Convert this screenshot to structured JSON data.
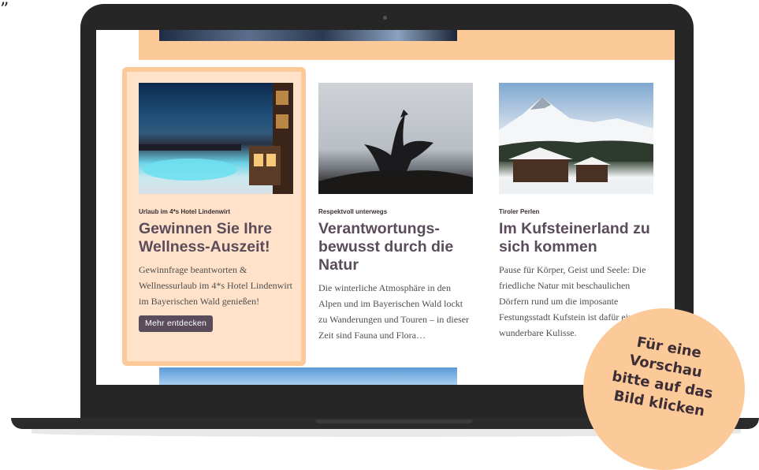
{
  "quote_mark": "”",
  "colors": {
    "accent": "#fcc998",
    "title": "#5a4c5b",
    "button": "#5a4c5b",
    "lid": "#262626"
  },
  "cards": [
    {
      "tag": "Urlaub im 4*s Hotel Lindenwirt",
      "title": "Gewinnen Sie Ihre Wellness-Auszeit!",
      "text": "Gewinnfrage beantworten & Wellnessurlaub im 4*s Hotel Lindenwirt im Bayerischen Wald genießen!",
      "button": "Mehr entdecken"
    },
    {
      "tag": "Respektvoll unterwegs",
      "title": "Verantwortungs-bewusst durch die Natur",
      "text": "Die winterliche Atmosphäre in den Alpen und im Bayerischen Wald lockt zu Wanderungen und Touren – in dieser Zeit sind Fauna und Flora…"
    },
    {
      "tag": "Tiroler Perlen",
      "title": "Im Kufsteinerland zu sich kommen",
      "text": "Pause für Körper, Geist und Seele: Die friedliche Natur mit beschaulichen Dörfern rund um die imposante Festungsstadt Kufstein ist dafür eine wunderbare Kulisse."
    }
  ],
  "badge": {
    "lines": [
      "Für eine",
      "Vorschau",
      "bitte auf das",
      "Bild klicken"
    ]
  }
}
